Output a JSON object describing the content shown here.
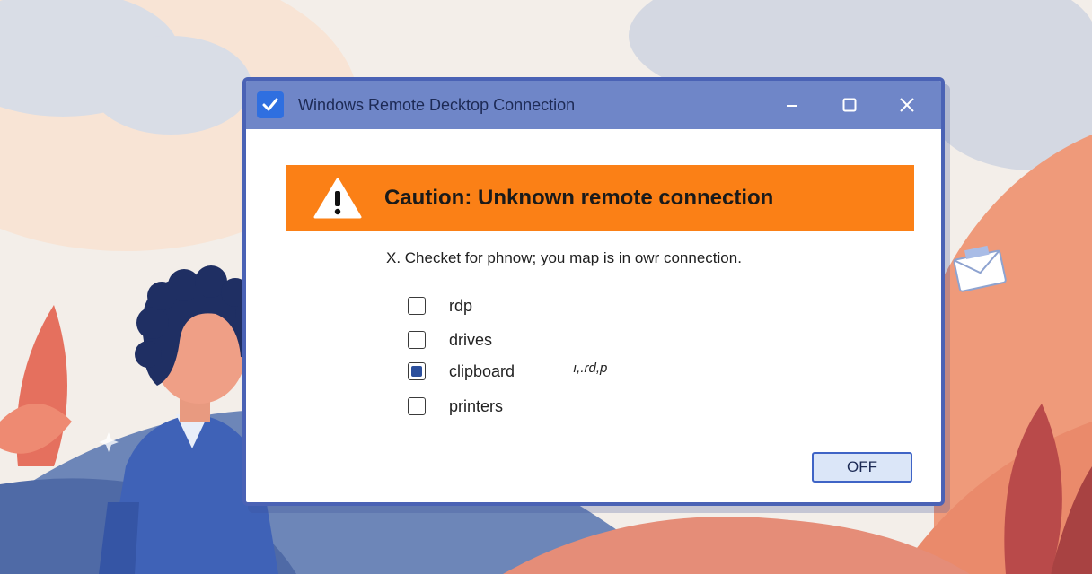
{
  "window": {
    "title": "Windows Remote Decktop Connection"
  },
  "banner": {
    "text": "Caution: Unknown remote connection"
  },
  "description": "X. Checket for phnow; you map is in owr connection.",
  "options": [
    {
      "label": "rdp",
      "checked": false
    },
    {
      "label": "drives",
      "checked": false
    },
    {
      "label": "clipboard",
      "checked": true
    },
    {
      "label": "printers",
      "checked": false
    }
  ],
  "scribble": "ı,.rd,p",
  "off_button": "OFF",
  "colors": {
    "titlebar": "#6f86c8",
    "banner": "#fb8016",
    "accent": "#3f64c6"
  }
}
